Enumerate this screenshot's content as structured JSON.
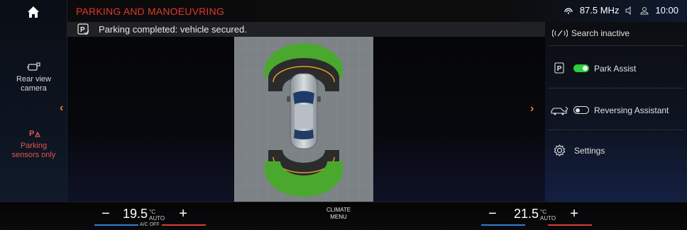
{
  "sidebar": {
    "home_icon": "home-icon",
    "items": [
      {
        "label_line1": "Rear view",
        "label_line2": "camera",
        "icon": "rear-camera-icon"
      },
      {
        "label_line1": "Parking",
        "label_line2": "sensors only",
        "icon": "parking-sensor-icon"
      }
    ]
  },
  "header": {
    "title": "PARKING AND MANOEUVRING",
    "radio": "87.5 MHz",
    "time": "10:00"
  },
  "info": {
    "message": "Parking completed: vehicle secured."
  },
  "right_panel": {
    "search": "Search inactive",
    "park_assist": {
      "label": "Park Assist",
      "enabled": true
    },
    "reversing": {
      "label": "Reversing Assistant",
      "enabled": false
    },
    "settings": "Settings"
  },
  "climate": {
    "left_temp": "19.5",
    "right_temp": "21.5",
    "unit": "°C",
    "auto": "AUTO",
    "ac_status": "A/C OFF",
    "menu_line1": "CLIMATE",
    "menu_line2": "MENU",
    "minus": "−",
    "plus": "+"
  },
  "colors": {
    "title_red": "#e0392e",
    "chevron_orange": "#ff7a1a",
    "toggle_green": "#2ecc40"
  }
}
